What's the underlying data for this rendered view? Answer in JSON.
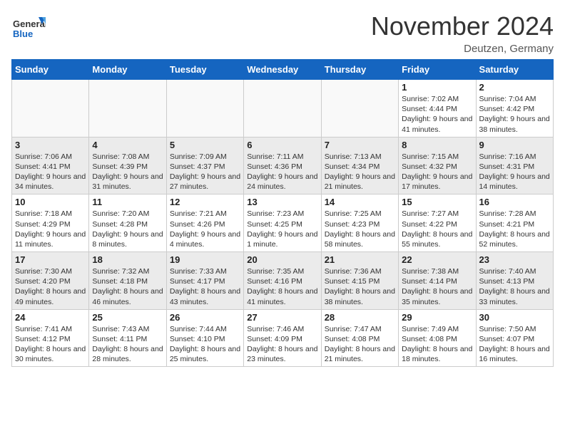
{
  "header": {
    "logo_general": "General",
    "logo_blue": "Blue",
    "title": "November 2024",
    "location": "Deutzen, Germany"
  },
  "days_of_week": [
    "Sunday",
    "Monday",
    "Tuesday",
    "Wednesday",
    "Thursday",
    "Friday",
    "Saturday"
  ],
  "weeks": [
    [
      {
        "day": "",
        "info": ""
      },
      {
        "day": "",
        "info": ""
      },
      {
        "day": "",
        "info": ""
      },
      {
        "day": "",
        "info": ""
      },
      {
        "day": "",
        "info": ""
      },
      {
        "day": "1",
        "info": "Sunrise: 7:02 AM\nSunset: 4:44 PM\nDaylight: 9 hours and 41 minutes."
      },
      {
        "day": "2",
        "info": "Sunrise: 7:04 AM\nSunset: 4:42 PM\nDaylight: 9 hours and 38 minutes."
      }
    ],
    [
      {
        "day": "3",
        "info": "Sunrise: 7:06 AM\nSunset: 4:41 PM\nDaylight: 9 hours and 34 minutes."
      },
      {
        "day": "4",
        "info": "Sunrise: 7:08 AM\nSunset: 4:39 PM\nDaylight: 9 hours and 31 minutes."
      },
      {
        "day": "5",
        "info": "Sunrise: 7:09 AM\nSunset: 4:37 PM\nDaylight: 9 hours and 27 minutes."
      },
      {
        "day": "6",
        "info": "Sunrise: 7:11 AM\nSunset: 4:36 PM\nDaylight: 9 hours and 24 minutes."
      },
      {
        "day": "7",
        "info": "Sunrise: 7:13 AM\nSunset: 4:34 PM\nDaylight: 9 hours and 21 minutes."
      },
      {
        "day": "8",
        "info": "Sunrise: 7:15 AM\nSunset: 4:32 PM\nDaylight: 9 hours and 17 minutes."
      },
      {
        "day": "9",
        "info": "Sunrise: 7:16 AM\nSunset: 4:31 PM\nDaylight: 9 hours and 14 minutes."
      }
    ],
    [
      {
        "day": "10",
        "info": "Sunrise: 7:18 AM\nSunset: 4:29 PM\nDaylight: 9 hours and 11 minutes."
      },
      {
        "day": "11",
        "info": "Sunrise: 7:20 AM\nSunset: 4:28 PM\nDaylight: 9 hours and 8 minutes."
      },
      {
        "day": "12",
        "info": "Sunrise: 7:21 AM\nSunset: 4:26 PM\nDaylight: 9 hours and 4 minutes."
      },
      {
        "day": "13",
        "info": "Sunrise: 7:23 AM\nSunset: 4:25 PM\nDaylight: 9 hours and 1 minute."
      },
      {
        "day": "14",
        "info": "Sunrise: 7:25 AM\nSunset: 4:23 PM\nDaylight: 8 hours and 58 minutes."
      },
      {
        "day": "15",
        "info": "Sunrise: 7:27 AM\nSunset: 4:22 PM\nDaylight: 8 hours and 55 minutes."
      },
      {
        "day": "16",
        "info": "Sunrise: 7:28 AM\nSunset: 4:21 PM\nDaylight: 8 hours and 52 minutes."
      }
    ],
    [
      {
        "day": "17",
        "info": "Sunrise: 7:30 AM\nSunset: 4:20 PM\nDaylight: 8 hours and 49 minutes."
      },
      {
        "day": "18",
        "info": "Sunrise: 7:32 AM\nSunset: 4:18 PM\nDaylight: 8 hours and 46 minutes."
      },
      {
        "day": "19",
        "info": "Sunrise: 7:33 AM\nSunset: 4:17 PM\nDaylight: 8 hours and 43 minutes."
      },
      {
        "day": "20",
        "info": "Sunrise: 7:35 AM\nSunset: 4:16 PM\nDaylight: 8 hours and 41 minutes."
      },
      {
        "day": "21",
        "info": "Sunrise: 7:36 AM\nSunset: 4:15 PM\nDaylight: 8 hours and 38 minutes."
      },
      {
        "day": "22",
        "info": "Sunrise: 7:38 AM\nSunset: 4:14 PM\nDaylight: 8 hours and 35 minutes."
      },
      {
        "day": "23",
        "info": "Sunrise: 7:40 AM\nSunset: 4:13 PM\nDaylight: 8 hours and 33 minutes."
      }
    ],
    [
      {
        "day": "24",
        "info": "Sunrise: 7:41 AM\nSunset: 4:12 PM\nDaylight: 8 hours and 30 minutes."
      },
      {
        "day": "25",
        "info": "Sunrise: 7:43 AM\nSunset: 4:11 PM\nDaylight: 8 hours and 28 minutes."
      },
      {
        "day": "26",
        "info": "Sunrise: 7:44 AM\nSunset: 4:10 PM\nDaylight: 8 hours and 25 minutes."
      },
      {
        "day": "27",
        "info": "Sunrise: 7:46 AM\nSunset: 4:09 PM\nDaylight: 8 hours and 23 minutes."
      },
      {
        "day": "28",
        "info": "Sunrise: 7:47 AM\nSunset: 4:08 PM\nDaylight: 8 hours and 21 minutes."
      },
      {
        "day": "29",
        "info": "Sunrise: 7:49 AM\nSunset: 4:08 PM\nDaylight: 8 hours and 18 minutes."
      },
      {
        "day": "30",
        "info": "Sunrise: 7:50 AM\nSunset: 4:07 PM\nDaylight: 8 hours and 16 minutes."
      }
    ]
  ]
}
